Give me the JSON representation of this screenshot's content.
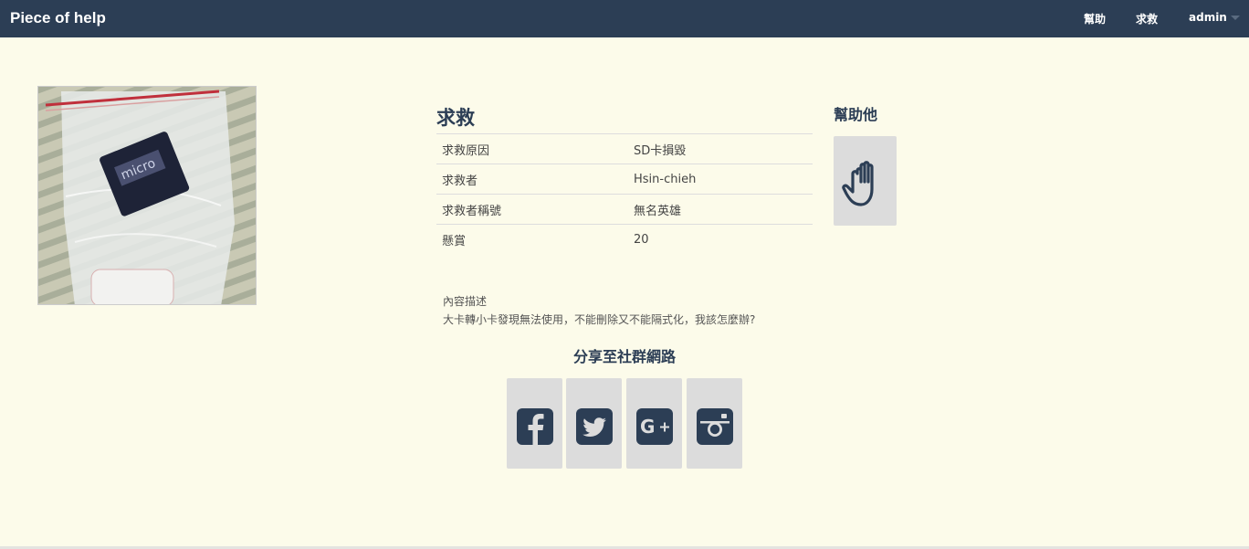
{
  "navbar": {
    "brand": "Piece of help",
    "links": [
      "幫助",
      "求救"
    ],
    "user": "admin"
  },
  "post": {
    "heading": "求救",
    "rows": [
      {
        "label": "求救原因",
        "value": "SD卡損毀"
      },
      {
        "label": "求救者",
        "value": "Hsin-chieh"
      },
      {
        "label": "求救者稱號",
        "value": "無名英雄"
      },
      {
        "label": "懸賞",
        "value": "20"
      }
    ],
    "description_label": "內容描述",
    "description": "大卡轉小卡發現無法使用，不能刪除又不能隔式化，我該怎麼辦?"
  },
  "share": {
    "title": "分享至社群網路",
    "icons": [
      "facebook-icon",
      "twitter-icon",
      "google-plus-icon",
      "instagram-icon"
    ]
  },
  "help": {
    "title": "幫助他",
    "icon": "hand-icon"
  },
  "colors": {
    "navbar": "#2c3e55",
    "background": "#fcfbea",
    "button": "#dcdcdc",
    "accent": "#2c3e55"
  }
}
